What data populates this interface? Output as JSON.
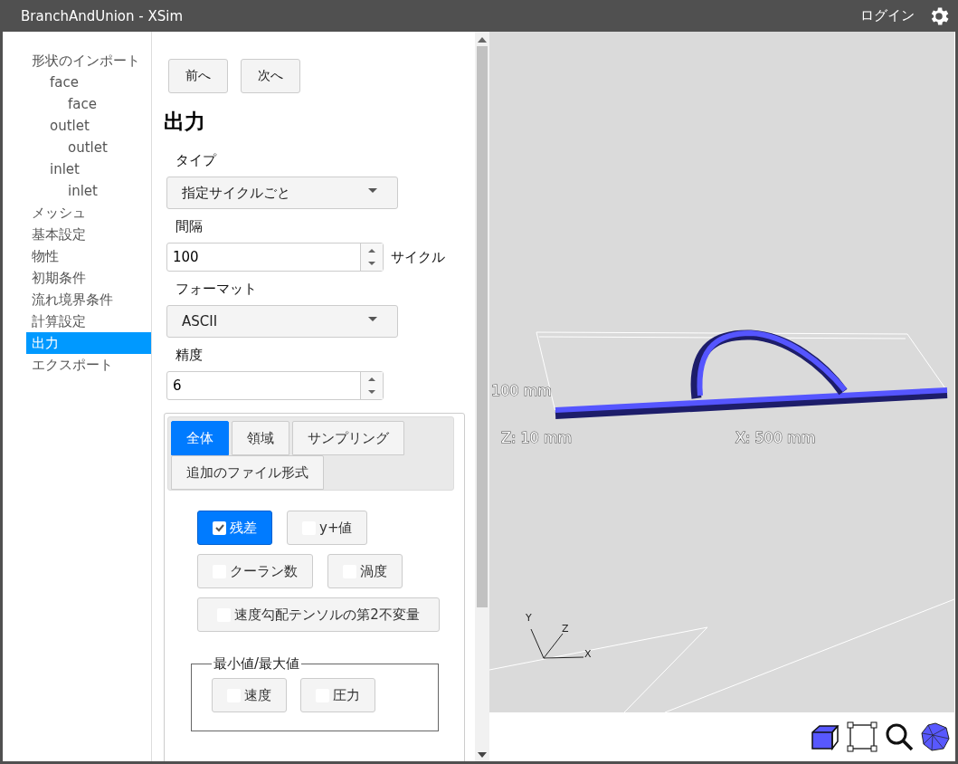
{
  "window": {
    "title": "BranchAndUnion - XSim",
    "login": "ログイン"
  },
  "sidebar": {
    "items": [
      {
        "label": "形状のインポート",
        "selected": false,
        "children": [
          {
            "label": "face",
            "selected": false,
            "children": [
              {
                "label": "face",
                "selected": false
              }
            ]
          },
          {
            "label": "outlet",
            "selected": false,
            "children": [
              {
                "label": "outlet",
                "selected": false
              }
            ]
          },
          {
            "label": "inlet",
            "selected": false,
            "children": [
              {
                "label": "inlet",
                "selected": false
              }
            ]
          }
        ]
      },
      {
        "label": "メッシュ",
        "selected": false
      },
      {
        "label": "基本設定",
        "selected": false
      },
      {
        "label": "物性",
        "selected": false
      },
      {
        "label": "初期条件",
        "selected": false
      },
      {
        "label": "流れ境界条件",
        "selected": false
      },
      {
        "label": "計算設定",
        "selected": false
      },
      {
        "label": "出力",
        "selected": true
      },
      {
        "label": "エクスポート",
        "selected": false
      }
    ]
  },
  "nav_buttons": [
    "前へ",
    "次へ"
  ],
  "heading": "出力",
  "fields": [
    {
      "kind": "select",
      "label": "タイプ",
      "value": "指定サイクルごと"
    },
    {
      "kind": "number",
      "label": "間隔",
      "value": "100",
      "unit": "サイクル"
    },
    {
      "kind": "select",
      "label": "フォーマット",
      "value": "ASCII"
    },
    {
      "kind": "number",
      "label": "精度",
      "value": "6"
    }
  ],
  "tabs": [
    {
      "label": "全体",
      "selected": true
    },
    {
      "label": "領域",
      "selected": false
    },
    {
      "label": "サンプリング",
      "selected": false
    },
    {
      "label": "追加のファイル形式",
      "selected": false
    }
  ],
  "toggles": [
    {
      "label": "残差",
      "checked": true
    },
    {
      "label": "y+値",
      "checked": false
    },
    {
      "label": "クーラン数",
      "checked": false
    },
    {
      "label": "渦度",
      "checked": false
    },
    {
      "label": "速度勾配テンソルの第2不変量",
      "checked": false
    }
  ],
  "minmax": {
    "legend": "最小値/最大値",
    "toggles": [
      {
        "label": "速度",
        "checked": false
      },
      {
        "label": "圧力",
        "checked": false
      }
    ]
  },
  "viewport": {
    "dimension_labels": [
      "100 mm",
      "Z: 10 mm",
      "X: 500 mm"
    ],
    "axis_labels": [
      "Y",
      "Z",
      "X"
    ]
  }
}
